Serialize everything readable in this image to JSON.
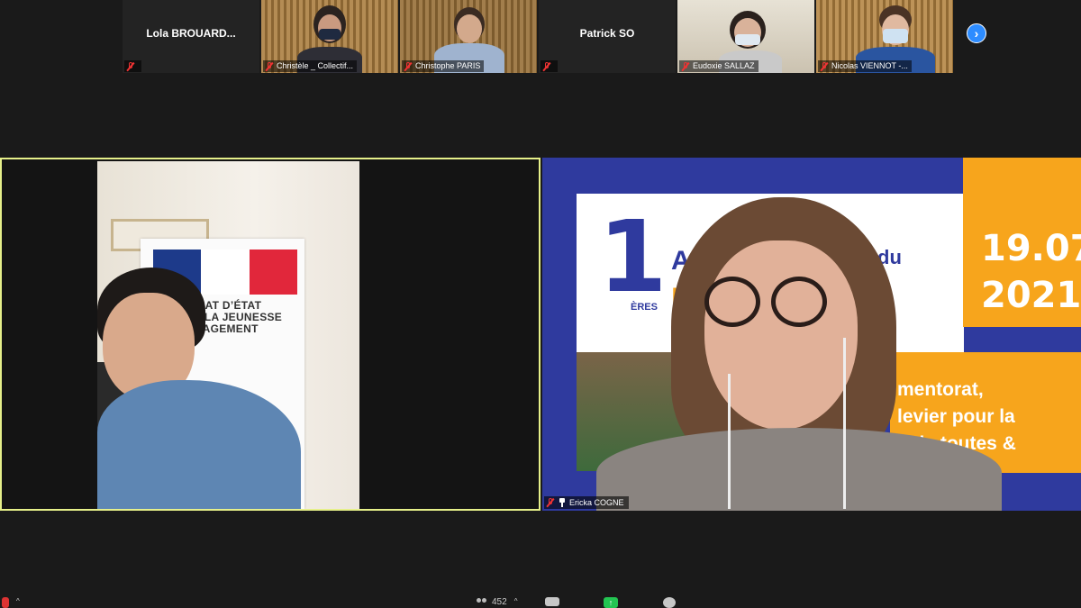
{
  "participants_strip": {
    "tiles": [
      {
        "name": "Lola BROUARD...",
        "mode": "name"
      },
      {
        "name": "Christèle _ Collectif...",
        "mode": "video"
      },
      {
        "name": "Christophe PARIS",
        "mode": "video"
      },
      {
        "name": "Patrick SO",
        "mode": "name"
      },
      {
        "name": "Eudoxie SALLAZ",
        "mode": "video"
      },
      {
        "name": "Nicolas VIENNOT -...",
        "mode": "video"
      }
    ],
    "next_page_icon": "chevron-right-icon"
  },
  "speaker_view": {
    "left": {
      "name": "",
      "active_speaker": true,
      "banner_text": "ARIAT D’ÉTAT\nDE LA JEUNESSE\nNGAGEMENT"
    },
    "right": {
      "name": "Ericka COGNE",
      "pinned": true,
      "slide": {
        "number": "1",
        "superscript": "ÈRES",
        "word_a": "A",
        "word_du": "du",
        "word_m": "M",
        "word_t": "t",
        "date_line1": "19.07",
        "date_line2": "2021",
        "line1": "mentorat,",
        "line2": "levier pour la",
        "line3": "e de toutes &"
      }
    }
  },
  "toolbar": {
    "participants_count": "452",
    "caret": "^"
  },
  "colors": {
    "background": "#1a1a1a",
    "active_speaker_border": "#e6f08a",
    "slide_blue": "#2f3a9e",
    "slide_orange": "#f7a51c",
    "next_button": "#2d8cff",
    "muted_red": "#e33",
    "share_green": "#23c552"
  }
}
